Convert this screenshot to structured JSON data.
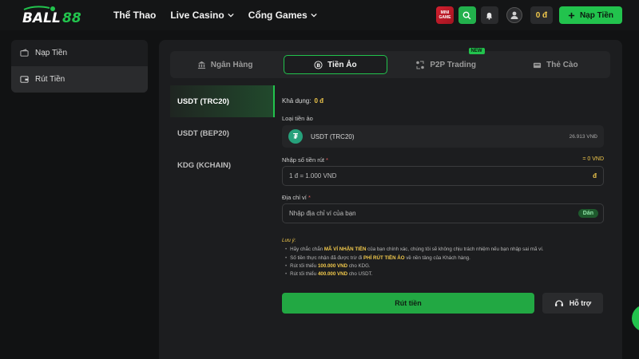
{
  "header": {
    "logo_text": "BALL88",
    "nav": [
      {
        "label": "Thể Thao"
      },
      {
        "label": "Live Casino"
      },
      {
        "label": "Cổng Games"
      }
    ],
    "mini_game_line1": "MINI",
    "mini_game_line2": "GAME",
    "balance": "0 đ",
    "deposit_label": "Nạp Tiền"
  },
  "sidebar": {
    "items": [
      {
        "label": "Nạp Tiền",
        "active": false
      },
      {
        "label": "Rút Tiền",
        "active": true
      }
    ]
  },
  "tabs": [
    {
      "label": "Ngân Hàng",
      "active": false
    },
    {
      "label": "Tiền Ảo",
      "active": true
    },
    {
      "label": "P2P Trading",
      "active": false,
      "badge": "NEW"
    },
    {
      "label": "Thẻ Cào",
      "active": false
    }
  ],
  "coins": [
    {
      "label": "USDT (TRC20)",
      "active": true
    },
    {
      "label": "USDT (BEP20)",
      "active": false
    },
    {
      "label": "KDG (KCHAIN)",
      "active": false
    }
  ],
  "form": {
    "available_label": "Khả dụng:",
    "available_value": "0 đ",
    "coin_type_label": "Loại tiền ảo",
    "coin_symbol": "₮",
    "coin_name": "USDT (TRC20)",
    "coin_rate": "26.913 VNĐ",
    "amount_label": "Nhập số tiền rút",
    "amount_required": "*",
    "amount_equiv": "= 0 VND",
    "amount_placeholder": "1 đ = 1.000 VND",
    "amount_unit": "đ",
    "address_label": "Địa chỉ ví",
    "address_required": "*",
    "address_placeholder": "Nhập địa chỉ ví của bạn",
    "paste_label": "Dán"
  },
  "notes": {
    "title": "Lưu ý:",
    "line1_a": "Hãy chắc chắn",
    "line1_hl": "MÃ VÍ NHẬN TIỀN",
    "line1_b": "của bạn chính xác, chúng tôi sẽ không chịu trách nhiệm nếu bạn nhập sai mã ví.",
    "line2_a": "Số tiền thực nhận đã được trừ đi",
    "line2_hl": "PHÍ RÚT TIỀN ẢO",
    "line2_b": "về nền tảng của Khách hàng.",
    "line3_a": "Rút tối thiểu",
    "line3_hl": "100.000 VND",
    "line3_b": "cho KDG.",
    "line4_a": "Rút tối thiểu",
    "line4_hl": "400.000 VND",
    "line4_b": "cho USDT."
  },
  "actions": {
    "withdraw_label": "Rút tiền",
    "support_label": "Hỗ trợ"
  },
  "colors": {
    "accent": "#22c34d",
    "highlight": "#f2c94c",
    "background": "#111213",
    "panel": "#1c1d1f"
  }
}
